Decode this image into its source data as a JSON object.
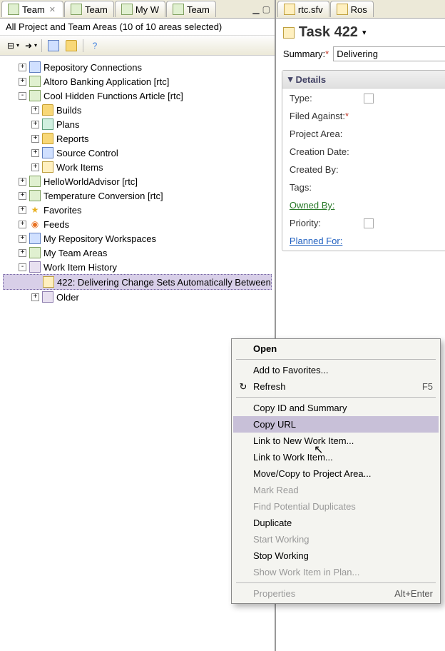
{
  "left": {
    "tabs": [
      {
        "label": "Team",
        "active": true,
        "closable": true
      },
      {
        "label": "Team"
      },
      {
        "label": "My W"
      },
      {
        "label": "Team"
      }
    ],
    "info_bar": "All Project and Team Areas (10 of 10 areas selected)",
    "tree": [
      {
        "exp": "+",
        "label": "Repository Connections",
        "icon": "repo"
      },
      {
        "exp": "+",
        "label": "Altoro Banking Application [rtc]",
        "icon": "proj"
      },
      {
        "exp": "-",
        "label": "Cool Hidden Functions Article [rtc]",
        "icon": "proj",
        "children": [
          {
            "exp": "+",
            "label": "Builds",
            "icon": "folder"
          },
          {
            "exp": "+",
            "label": "Plans",
            "icon": "plan"
          },
          {
            "exp": "+",
            "label": "Reports",
            "icon": "folder"
          },
          {
            "exp": "+",
            "label": "Source Control",
            "icon": "repo"
          },
          {
            "exp": "+",
            "label": "Work Items",
            "icon": "task"
          }
        ]
      },
      {
        "exp": "+",
        "label": "HelloWorldAdvisor [rtc]",
        "icon": "proj"
      },
      {
        "exp": "+",
        "label": "Temperature Conversion [rtc]",
        "icon": "proj"
      },
      {
        "exp": "+",
        "label": "Favorites",
        "icon": "star"
      },
      {
        "exp": "+",
        "label": "Feeds",
        "icon": "feed"
      },
      {
        "exp": "+",
        "label": "My Repository Workspaces",
        "icon": "repo"
      },
      {
        "exp": "+",
        "label": "My Team Areas",
        "icon": "proj"
      },
      {
        "exp": "-",
        "label": "Work Item History",
        "icon": "hist",
        "children": [
          {
            "exp": " ",
            "label": "422: Delivering Change Sets Automatically Between",
            "icon": "task",
            "selected": true
          },
          {
            "exp": "+",
            "label": "Older",
            "icon": "hist"
          }
        ]
      }
    ]
  },
  "context_menu": [
    {
      "label": "Open",
      "bold": true
    },
    {
      "sep": true
    },
    {
      "label": "Add to Favorites..."
    },
    {
      "label": "Refresh",
      "shortcut": "F5",
      "icon": "refresh"
    },
    {
      "sep": true
    },
    {
      "label": "Copy ID and Summary"
    },
    {
      "label": "Copy URL",
      "hover": true
    },
    {
      "label": "Link to New Work Item..."
    },
    {
      "label": "Link to Work Item..."
    },
    {
      "label": "Move/Copy to Project Area..."
    },
    {
      "label": "Mark Read",
      "disabled": true
    },
    {
      "label": "Find Potential Duplicates",
      "disabled": true
    },
    {
      "label": "Duplicate"
    },
    {
      "label": "Start Working",
      "disabled": true
    },
    {
      "label": "Stop Working"
    },
    {
      "label": "Show Work Item in Plan...",
      "disabled": true
    },
    {
      "sep": true
    },
    {
      "label": "Properties",
      "shortcut": "Alt+Enter",
      "disabled": true
    }
  ],
  "right": {
    "tabs": [
      {
        "label": "rtc.sfv"
      },
      {
        "label": "Ros"
      }
    ],
    "title": "Task 422",
    "summary_label": "Summary:",
    "summary_value": "Delivering",
    "details_title": "Details",
    "fields": [
      {
        "label": "Type:",
        "box": true
      },
      {
        "label": "Filed Against:",
        "required": true
      },
      {
        "label": "Project Area:"
      },
      {
        "label": "Creation Date:"
      },
      {
        "label": "Created By:"
      },
      {
        "label": "Tags:"
      },
      {
        "label": "Owned By:",
        "link": "green"
      },
      {
        "label": "Priority:",
        "box": true
      },
      {
        "label": "Planned For:",
        "link": "blue"
      }
    ]
  }
}
